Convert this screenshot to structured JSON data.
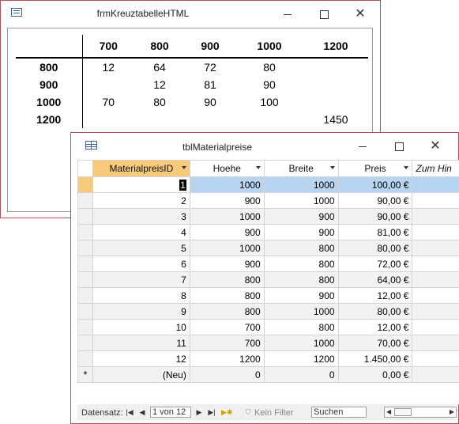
{
  "form_window": {
    "title": "frmKreuztabelleHTML",
    "crosstab": {
      "columns": [
        "700",
        "800",
        "900",
        "1000",
        "1200"
      ],
      "rows": [
        {
          "label": "800",
          "values": [
            "12",
            "64",
            "72",
            "80",
            ""
          ]
        },
        {
          "label": "900",
          "values": [
            "",
            "12",
            "81",
            "90",
            ""
          ]
        },
        {
          "label": "1000",
          "values": [
            "70",
            "80",
            "90",
            "100",
            ""
          ]
        },
        {
          "label": "1200",
          "values": [
            "",
            "",
            "",
            "",
            "1450"
          ]
        }
      ]
    }
  },
  "table_window": {
    "title": "tblMaterialpreise",
    "columns": [
      "MaterialpreisID",
      "Hoehe",
      "Breite",
      "Preis",
      "Zum Hin"
    ],
    "rows": [
      {
        "id": "1",
        "hoehe": "1000",
        "breite": "1000",
        "preis": "100,00 €"
      },
      {
        "id": "2",
        "hoehe": "900",
        "breite": "1000",
        "preis": "90,00 €"
      },
      {
        "id": "3",
        "hoehe": "1000",
        "breite": "900",
        "preis": "90,00 €"
      },
      {
        "id": "4",
        "hoehe": "900",
        "breite": "900",
        "preis": "81,00 €"
      },
      {
        "id": "5",
        "hoehe": "1000",
        "breite": "800",
        "preis": "80,00 €"
      },
      {
        "id": "6",
        "hoehe": "900",
        "breite": "800",
        "preis": "72,00 €"
      },
      {
        "id": "7",
        "hoehe": "800",
        "breite": "800",
        "preis": "64,00 €"
      },
      {
        "id": "8",
        "hoehe": "800",
        "breite": "900",
        "preis": "12,00 €"
      },
      {
        "id": "9",
        "hoehe": "800",
        "breite": "1000",
        "preis": "80,00 €"
      },
      {
        "id": "10",
        "hoehe": "700",
        "breite": "800",
        "preis": "12,00 €"
      },
      {
        "id": "11",
        "hoehe": "700",
        "breite": "1000",
        "preis": "70,00 €"
      },
      {
        "id": "12",
        "hoehe": "1200",
        "breite": "1200",
        "preis": "1.450,00 €"
      }
    ],
    "new_row": {
      "marker": "*",
      "id": "(Neu)",
      "hoehe": "0",
      "breite": "0",
      "preis": "0,00 €"
    },
    "navigation": {
      "label": "Datensatz:",
      "record_position": "1 von 12",
      "filter_label": "Kein Filter",
      "search_placeholder": "Suchen"
    }
  },
  "colors": {
    "window_border": "#b2505e",
    "selected_header": "#f7c97a",
    "selected_row": "#b7d4f0"
  }
}
